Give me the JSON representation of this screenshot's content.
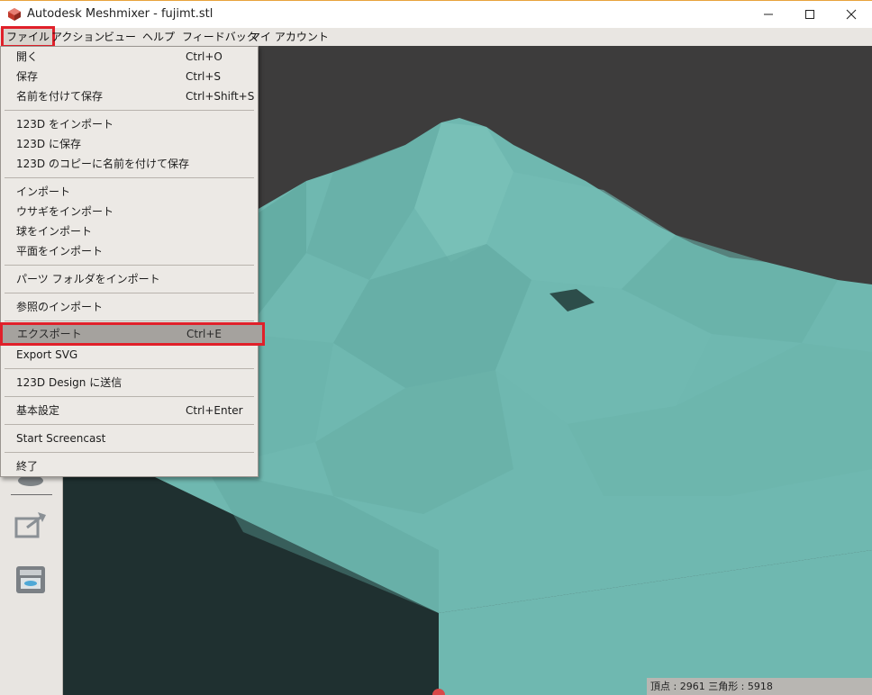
{
  "window": {
    "title": "Autodesk Meshmixer - fujimt.stl"
  },
  "menubar": {
    "items": [
      {
        "label": "ファイル"
      },
      {
        "label": "アクション"
      },
      {
        "label": "ビュー"
      },
      {
        "label": "ヘルプ"
      },
      {
        "label": "フィードバック"
      },
      {
        "label": "マイ アカウント"
      }
    ]
  },
  "file_menu": {
    "items": [
      {
        "label": "開く",
        "shortcut": "Ctrl+O"
      },
      {
        "label": "保存",
        "shortcut": "Ctrl+S"
      },
      {
        "label": "名前を付けて保存",
        "shortcut": "Ctrl+Shift+S"
      },
      {
        "label": "123D をインポート",
        "shortcut": ""
      },
      {
        "label": "123D に保存",
        "shortcut": ""
      },
      {
        "label": "123D のコピーに名前を付けて保存",
        "shortcut": ""
      },
      {
        "label": "インポート",
        "shortcut": ""
      },
      {
        "label": "ウサギをインポート",
        "shortcut": ""
      },
      {
        "label": "球をインポート",
        "shortcut": ""
      },
      {
        "label": "平面をインポート",
        "shortcut": ""
      },
      {
        "label": "パーツ フォルダをインポート",
        "shortcut": ""
      },
      {
        "label": "参照のインポート",
        "shortcut": ""
      },
      {
        "label": "エクスポート",
        "shortcut": "Ctrl+E"
      },
      {
        "label": "Export SVG",
        "shortcut": ""
      },
      {
        "label": "123D Design に送信",
        "shortcut": ""
      },
      {
        "label": "基本設定",
        "shortcut": "Ctrl+Enter"
      },
      {
        "label": "Start Screencast",
        "shortcut": ""
      },
      {
        "label": "終了",
        "shortcut": ""
      }
    ]
  },
  "status": {
    "text": "頂点 : 2961 三角形 : 5918"
  },
  "colors": {
    "mesh": "#6fb8b0",
    "mesh_side": "#1f3030",
    "highlight_outline": "#e0202a"
  }
}
